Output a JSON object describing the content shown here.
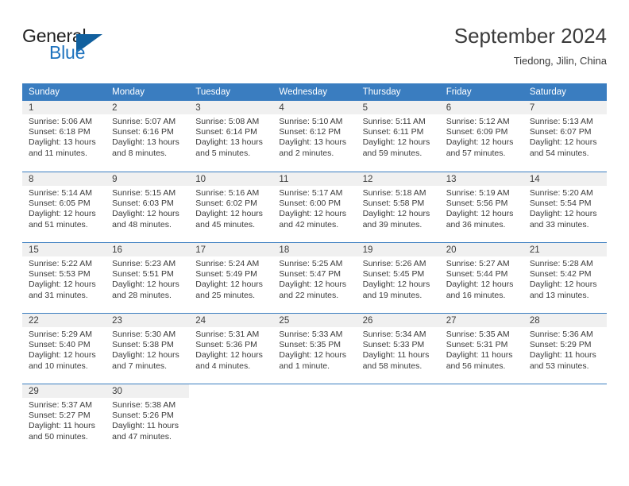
{
  "brand": {
    "name_part1": "General",
    "name_part2": "Blue",
    "triangle_icon": "brand-triangle-icon"
  },
  "header": {
    "title": "September 2024",
    "subtitle": "Tiedong, Jilin, China"
  },
  "colors": {
    "header_blue": "#3a7dc0",
    "brand_blue": "#1e73be",
    "triangle_blue": "#11609e",
    "day_strip_gray": "#f0f0f0",
    "text": "#3b3b3b"
  },
  "calendar": {
    "weekday_headers": [
      "Sunday",
      "Monday",
      "Tuesday",
      "Wednesday",
      "Thursday",
      "Friday",
      "Saturday"
    ],
    "weeks": [
      [
        {
          "day": "1",
          "sunrise": "Sunrise: 5:06 AM",
          "sunset": "Sunset: 6:18 PM",
          "daylight_line1": "Daylight: 13 hours",
          "daylight_line2": "and 11 minutes."
        },
        {
          "day": "2",
          "sunrise": "Sunrise: 5:07 AM",
          "sunset": "Sunset: 6:16 PM",
          "daylight_line1": "Daylight: 13 hours",
          "daylight_line2": "and 8 minutes."
        },
        {
          "day": "3",
          "sunrise": "Sunrise: 5:08 AM",
          "sunset": "Sunset: 6:14 PM",
          "daylight_line1": "Daylight: 13 hours",
          "daylight_line2": "and 5 minutes."
        },
        {
          "day": "4",
          "sunrise": "Sunrise: 5:10 AM",
          "sunset": "Sunset: 6:12 PM",
          "daylight_line1": "Daylight: 13 hours",
          "daylight_line2": "and 2 minutes."
        },
        {
          "day": "5",
          "sunrise": "Sunrise: 5:11 AM",
          "sunset": "Sunset: 6:11 PM",
          "daylight_line1": "Daylight: 12 hours",
          "daylight_line2": "and 59 minutes."
        },
        {
          "day": "6",
          "sunrise": "Sunrise: 5:12 AM",
          "sunset": "Sunset: 6:09 PM",
          "daylight_line1": "Daylight: 12 hours",
          "daylight_line2": "and 57 minutes."
        },
        {
          "day": "7",
          "sunrise": "Sunrise: 5:13 AM",
          "sunset": "Sunset: 6:07 PM",
          "daylight_line1": "Daylight: 12 hours",
          "daylight_line2": "and 54 minutes."
        }
      ],
      [
        {
          "day": "8",
          "sunrise": "Sunrise: 5:14 AM",
          "sunset": "Sunset: 6:05 PM",
          "daylight_line1": "Daylight: 12 hours",
          "daylight_line2": "and 51 minutes."
        },
        {
          "day": "9",
          "sunrise": "Sunrise: 5:15 AM",
          "sunset": "Sunset: 6:03 PM",
          "daylight_line1": "Daylight: 12 hours",
          "daylight_line2": "and 48 minutes."
        },
        {
          "day": "10",
          "sunrise": "Sunrise: 5:16 AM",
          "sunset": "Sunset: 6:02 PM",
          "daylight_line1": "Daylight: 12 hours",
          "daylight_line2": "and 45 minutes."
        },
        {
          "day": "11",
          "sunrise": "Sunrise: 5:17 AM",
          "sunset": "Sunset: 6:00 PM",
          "daylight_line1": "Daylight: 12 hours",
          "daylight_line2": "and 42 minutes."
        },
        {
          "day": "12",
          "sunrise": "Sunrise: 5:18 AM",
          "sunset": "Sunset: 5:58 PM",
          "daylight_line1": "Daylight: 12 hours",
          "daylight_line2": "and 39 minutes."
        },
        {
          "day": "13",
          "sunrise": "Sunrise: 5:19 AM",
          "sunset": "Sunset: 5:56 PM",
          "daylight_line1": "Daylight: 12 hours",
          "daylight_line2": "and 36 minutes."
        },
        {
          "day": "14",
          "sunrise": "Sunrise: 5:20 AM",
          "sunset": "Sunset: 5:54 PM",
          "daylight_line1": "Daylight: 12 hours",
          "daylight_line2": "and 33 minutes."
        }
      ],
      [
        {
          "day": "15",
          "sunrise": "Sunrise: 5:22 AM",
          "sunset": "Sunset: 5:53 PM",
          "daylight_line1": "Daylight: 12 hours",
          "daylight_line2": "and 31 minutes."
        },
        {
          "day": "16",
          "sunrise": "Sunrise: 5:23 AM",
          "sunset": "Sunset: 5:51 PM",
          "daylight_line1": "Daylight: 12 hours",
          "daylight_line2": "and 28 minutes."
        },
        {
          "day": "17",
          "sunrise": "Sunrise: 5:24 AM",
          "sunset": "Sunset: 5:49 PM",
          "daylight_line1": "Daylight: 12 hours",
          "daylight_line2": "and 25 minutes."
        },
        {
          "day": "18",
          "sunrise": "Sunrise: 5:25 AM",
          "sunset": "Sunset: 5:47 PM",
          "daylight_line1": "Daylight: 12 hours",
          "daylight_line2": "and 22 minutes."
        },
        {
          "day": "19",
          "sunrise": "Sunrise: 5:26 AM",
          "sunset": "Sunset: 5:45 PM",
          "daylight_line1": "Daylight: 12 hours",
          "daylight_line2": "and 19 minutes."
        },
        {
          "day": "20",
          "sunrise": "Sunrise: 5:27 AM",
          "sunset": "Sunset: 5:44 PM",
          "daylight_line1": "Daylight: 12 hours",
          "daylight_line2": "and 16 minutes."
        },
        {
          "day": "21",
          "sunrise": "Sunrise: 5:28 AM",
          "sunset": "Sunset: 5:42 PM",
          "daylight_line1": "Daylight: 12 hours",
          "daylight_line2": "and 13 minutes."
        }
      ],
      [
        {
          "day": "22",
          "sunrise": "Sunrise: 5:29 AM",
          "sunset": "Sunset: 5:40 PM",
          "daylight_line1": "Daylight: 12 hours",
          "daylight_line2": "and 10 minutes."
        },
        {
          "day": "23",
          "sunrise": "Sunrise: 5:30 AM",
          "sunset": "Sunset: 5:38 PM",
          "daylight_line1": "Daylight: 12 hours",
          "daylight_line2": "and 7 minutes."
        },
        {
          "day": "24",
          "sunrise": "Sunrise: 5:31 AM",
          "sunset": "Sunset: 5:36 PM",
          "daylight_line1": "Daylight: 12 hours",
          "daylight_line2": "and 4 minutes."
        },
        {
          "day": "25",
          "sunrise": "Sunrise: 5:33 AM",
          "sunset": "Sunset: 5:35 PM",
          "daylight_line1": "Daylight: 12 hours",
          "daylight_line2": "and 1 minute."
        },
        {
          "day": "26",
          "sunrise": "Sunrise: 5:34 AM",
          "sunset": "Sunset: 5:33 PM",
          "daylight_line1": "Daylight: 11 hours",
          "daylight_line2": "and 58 minutes."
        },
        {
          "day": "27",
          "sunrise": "Sunrise: 5:35 AM",
          "sunset": "Sunset: 5:31 PM",
          "daylight_line1": "Daylight: 11 hours",
          "daylight_line2": "and 56 minutes."
        },
        {
          "day": "28",
          "sunrise": "Sunrise: 5:36 AM",
          "sunset": "Sunset: 5:29 PM",
          "daylight_line1": "Daylight: 11 hours",
          "daylight_line2": "and 53 minutes."
        }
      ],
      [
        {
          "day": "29",
          "sunrise": "Sunrise: 5:37 AM",
          "sunset": "Sunset: 5:27 PM",
          "daylight_line1": "Daylight: 11 hours",
          "daylight_line2": "and 50 minutes."
        },
        {
          "day": "30",
          "sunrise": "Sunrise: 5:38 AM",
          "sunset": "Sunset: 5:26 PM",
          "daylight_line1": "Daylight: 11 hours",
          "daylight_line2": "and 47 minutes."
        },
        {
          "day": "",
          "sunrise": "",
          "sunset": "",
          "daylight_line1": "",
          "daylight_line2": ""
        },
        {
          "day": "",
          "sunrise": "",
          "sunset": "",
          "daylight_line1": "",
          "daylight_line2": ""
        },
        {
          "day": "",
          "sunrise": "",
          "sunset": "",
          "daylight_line1": "",
          "daylight_line2": ""
        },
        {
          "day": "",
          "sunrise": "",
          "sunset": "",
          "daylight_line1": "",
          "daylight_line2": ""
        },
        {
          "day": "",
          "sunrise": "",
          "sunset": "",
          "daylight_line1": "",
          "daylight_line2": ""
        }
      ]
    ]
  }
}
